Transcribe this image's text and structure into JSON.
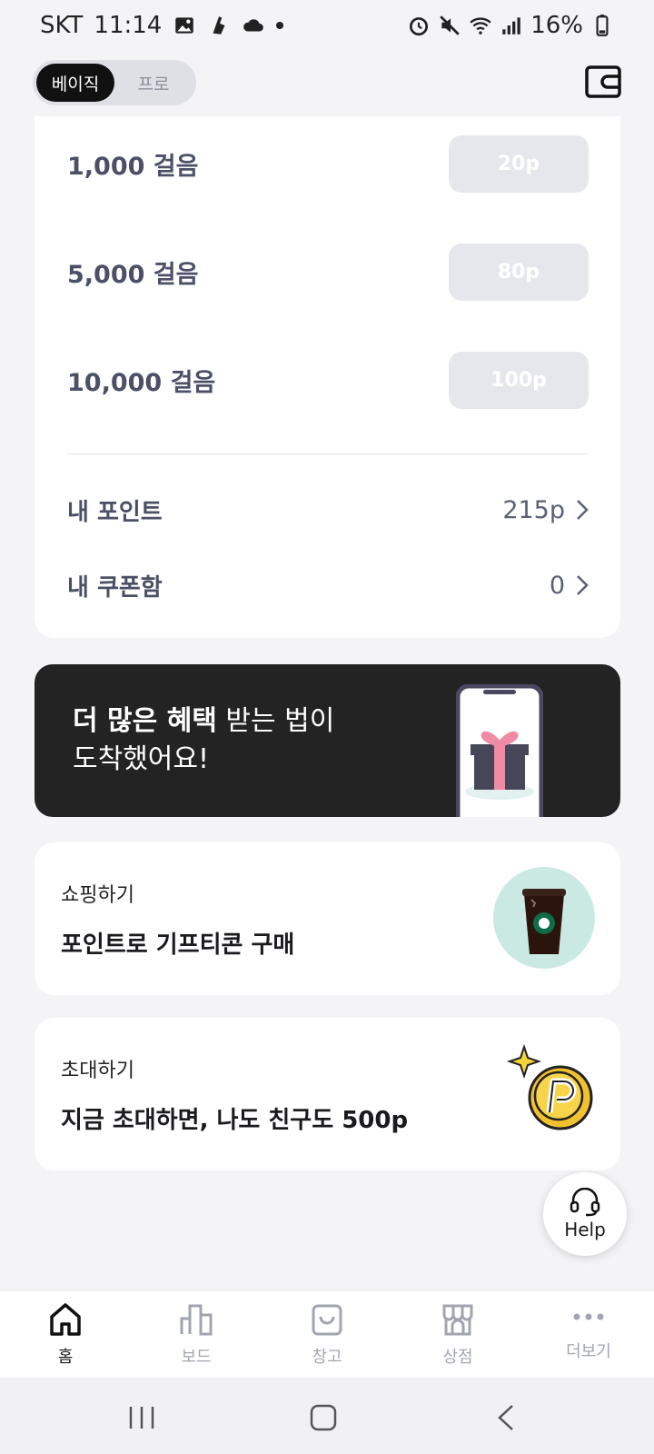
{
  "status_bar": {
    "carrier": "SKT",
    "time": "11:14",
    "battery": "16%"
  },
  "header": {
    "modes": [
      "베이직",
      "프로"
    ],
    "active_mode": "베이직",
    "wallet_icon": "wallet-icon"
  },
  "points_card": {
    "steps": [
      {
        "label": "1,000 걸음",
        "reward": "20p"
      },
      {
        "label": "5,000 걸음",
        "reward": "80p"
      },
      {
        "label": "10,000 걸음",
        "reward": "100p"
      }
    ],
    "my_points": {
      "label": "내 포인트",
      "value": "215p"
    },
    "my_coupons": {
      "label": "내 쿠폰함",
      "value": "0"
    }
  },
  "promo": {
    "bold": "더 많은 혜택",
    "rest_line1": " 받는 법이",
    "line2": "도착했어요!"
  },
  "shopping_card": {
    "sub": "쇼핑하기",
    "title": "포인트로 기프티콘 구매"
  },
  "invite_card": {
    "sub": "초대하기",
    "title": "지금 초대하면, 나도 친구도 500p"
  },
  "help": {
    "label": "Help"
  },
  "bottom_nav": {
    "items": [
      {
        "label": "홈",
        "icon": "home-icon"
      },
      {
        "label": "보드",
        "icon": "chart-icon"
      },
      {
        "label": "창고",
        "icon": "bag-icon"
      },
      {
        "label": "상점",
        "icon": "store-icon"
      },
      {
        "label": "더보기",
        "icon": "more-icon"
      }
    ],
    "active_index": 0
  },
  "colors": {
    "accent": "#111111",
    "muted": "#4b5067",
    "reward_disabled": "#e6e7ec",
    "banner": "#232323"
  }
}
